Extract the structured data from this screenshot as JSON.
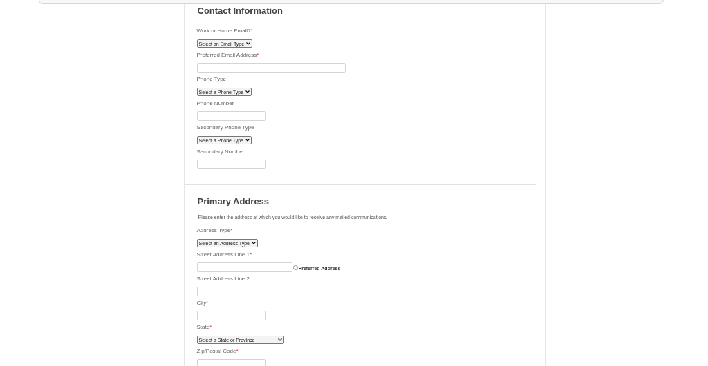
{
  "sections": [
    {
      "heading": "Contact Information",
      "fields": [
        {
          "kind": "select",
          "label": "Work or Home Email?",
          "mark": "*",
          "value": "Select an Email Type"
        },
        {
          "kind": "text",
          "label": "Preferred Email Address",
          "mark": "*"
        },
        {
          "kind": "select",
          "label": "Phone Type",
          "value": "Select a Phone Type"
        },
        {
          "kind": "text",
          "label": "Phone Number"
        },
        {
          "kind": "select",
          "label": "Secondary Phone Type",
          "value": "Select a Phone Type"
        },
        {
          "kind": "text",
          "label": "Secondary Number"
        }
      ]
    },
    {
      "heading": "Primary Address",
      "description": "Please enter the address at which you would like to receive any mailed communications.",
      "fields": [
        {
          "kind": "select",
          "label": "Address Type",
          "mark": "*",
          "value": "Select an Address Type"
        },
        {
          "kind": "text",
          "label": "Street Address Line 1",
          "mark": "*",
          "option": {
            "label": "Preferred Address",
            "checked": false
          }
        },
        {
          "kind": "text",
          "label": "Street Address Line 2"
        },
        {
          "kind": "text",
          "label": "City",
          "mark": "*"
        },
        {
          "kind": "select",
          "label": "State",
          "mark": "*",
          "value": "Select a State or Province"
        },
        {
          "kind": "text",
          "label": "Zip/Postal Code",
          "mark": "*"
        }
      ]
    }
  ]
}
